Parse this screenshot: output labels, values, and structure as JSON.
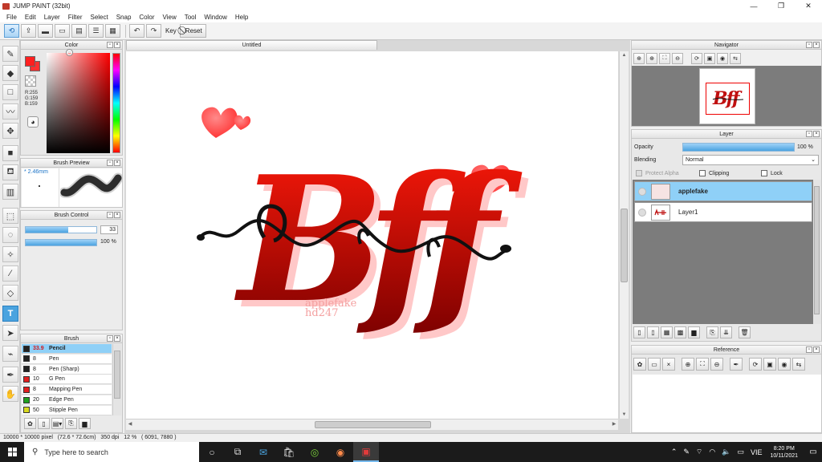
{
  "window": {
    "title": "JUMP PAINT (32bit)",
    "controls": [
      "—",
      "❐",
      "✕"
    ]
  },
  "menu": [
    "File",
    "Edit",
    "Layer",
    "Filter",
    "Select",
    "Snap",
    "Color",
    "View",
    "Tool",
    "Window",
    "Help"
  ],
  "toolbar": {
    "key_label": "Key",
    "reset_label": "Reset"
  },
  "color_panel": {
    "title": "Color",
    "r": "R:255",
    "g": "G:159",
    "b": "B:159",
    "foreground": "#ff1f1f"
  },
  "brush_preview": {
    "title": "Brush Preview",
    "size": "2.46mm"
  },
  "brush_control": {
    "title": "Brush Control",
    "size_value": "33",
    "size_fraction": 0.6,
    "opacity_label": "100 %",
    "opacity_fraction": 1.0
  },
  "brush_list": {
    "title": "Brush",
    "items": [
      {
        "size": "33.9",
        "name": "Pencil",
        "color": "#222222",
        "selected": true
      },
      {
        "size": "8",
        "name": "Pen",
        "color": "#222222",
        "selected": false
      },
      {
        "size": "8",
        "name": "Pen (Sharp)",
        "color": "#222222",
        "selected": false
      },
      {
        "size": "10",
        "name": "G Pen",
        "color": "#e02020",
        "selected": false
      },
      {
        "size": "8",
        "name": "Mapping Pen",
        "color": "#e02020",
        "selected": false
      },
      {
        "size": "20",
        "name": "Edge Pen",
        "color": "#20a020",
        "selected": false
      },
      {
        "size": "50",
        "name": "Stipple Pen",
        "color": "#d8d820",
        "selected": false
      }
    ]
  },
  "document": {
    "tab_title": "Untitled",
    "artwork": {
      "main_text": "Bff",
      "watermark_line1": "applefake",
      "watermark_line2": "hd247"
    }
  },
  "navigator": {
    "title": "Navigator",
    "preview_text": "Bff"
  },
  "layer_panel": {
    "title": "Layer",
    "opacity_label": "Opacity",
    "opacity_value": "100 %",
    "blending_label": "Blending",
    "blending_value": "Normal",
    "protect_alpha": "Protect Alpha",
    "clipping": "Clipping",
    "lock": "Lock",
    "layers": [
      {
        "name": "applefake",
        "selected": true
      },
      {
        "name": "Layer1",
        "selected": false
      }
    ]
  },
  "reference_panel": {
    "title": "Reference"
  },
  "status_bar": {
    "text": "10000 * 10000 pixel   (72.6 * 72.6cm)   350 dpi   12 %   ( 6091, 7880 )"
  },
  "taskbar": {
    "search_placeholder": "Type here to search",
    "language": "VIE",
    "time": "8:20 PM",
    "date": "10/11/2021"
  },
  "colors": {
    "accent": "#4aa3df",
    "selection": "#8fd0f7",
    "art_red": "#d01010"
  }
}
